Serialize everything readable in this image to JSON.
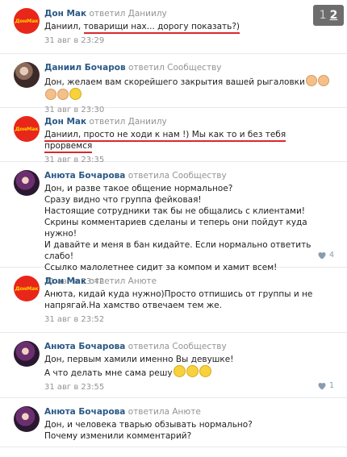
{
  "pager": {
    "inactive": "1",
    "active": "2"
  },
  "comments": [
    {
      "author": "Дон Мак",
      "action": "ответил",
      "target": "Даниилу",
      "text_plain": "Даниил, ",
      "text_hl": "товарищи нах... дорогу показать?)",
      "time": "31 авг в 23:29",
      "avatar": "donmak",
      "likes": "",
      "avatar_logo": "ДонМак"
    },
    {
      "author": "Даниил Бочаров",
      "action": "ответил",
      "target": "Сообществу",
      "text_plain": "Дон, желаем вам скорейшего закрытия вашей рыгаловки",
      "time": "31 авг в 23:30",
      "avatar": "photo",
      "likes": "",
      "emoji": [
        "clap",
        "clap",
        "clap",
        "clap",
        "laugh"
      ]
    },
    {
      "author": "Дон Мак",
      "action": "ответил",
      "target": "Даниилу",
      "text_plain": "",
      "text_hl": "Даниил, просто не ходи к нам !) Мы как то и без тебя прорвемся",
      "time": "31 авг в 23:35",
      "avatar": "donmak",
      "likes": "",
      "avatar_logo": "ДонМак"
    },
    {
      "author": "Анюта Бочарова",
      "action": "ответила",
      "target": "Сообществу",
      "text_plain": "Дон, и разве такое общение нормальное?\nСразу видно что группа фейковая!\nНастоящие сотрудники так бы не общались с клиентами!\nСкрины комментариев сделаны и теперь они пойдут куда нужно!\nИ давайте и меня в бан кидайте. Если нормально ответить слабо!\nСсылко малолетнее сидит за компом и хамит всем!",
      "time": "31 авг в 23:42",
      "avatar": "photo2",
      "likes": "4"
    },
    {
      "author": "Дон Мак",
      "action": "ответил",
      "target": "Анюте",
      "text_plain": "Анюта, кидай куда нужно)Просто отпишись от группы и не напрягай.На хамство отвечаем тем же.",
      "time": "31 авг в 23:52",
      "avatar": "donmak",
      "likes": "",
      "avatar_logo": "ДонМак"
    },
    {
      "author": "Анюта Бочарова",
      "action": "ответила",
      "target": "Сообществу",
      "text_plain": "Дон, первым хамили именно Вы девушке!\nА что делать мне сама решу",
      "time": "31 авг в 23:55",
      "avatar": "photo2",
      "likes": "1",
      "emoji": [
        "laugh",
        "laugh",
        "laugh"
      ]
    },
    {
      "author": "Анюта Бочарова",
      "action": "ответила",
      "target": "Анюте",
      "text_plain": "Дон, и человека тварью обзывать нормально?\nПочему изменили комментарий?",
      "time": "",
      "avatar": "photo2",
      "likes": ""
    }
  ]
}
